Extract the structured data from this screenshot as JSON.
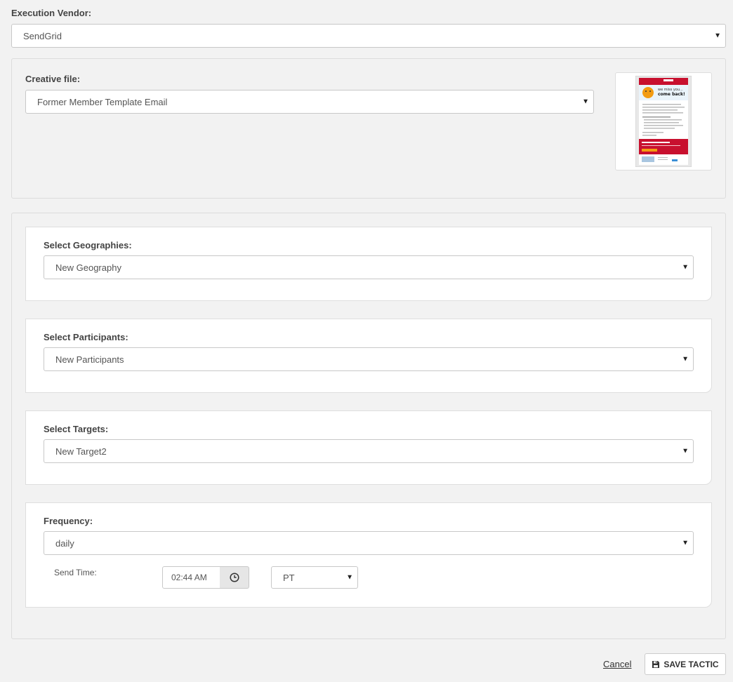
{
  "vendor": {
    "label": "Execution Vendor:",
    "value": "SendGrid"
  },
  "creative": {
    "label": "Creative file:",
    "value": "Former Member Template Email"
  },
  "geographies": {
    "label": "Select Geographies:",
    "value": "New Geography"
  },
  "participants": {
    "label": "Select Participants:",
    "value": "New Participants"
  },
  "targets": {
    "label": "Select Targets:",
    "value": "New Target2"
  },
  "frequency": {
    "label": "Frequency:",
    "value": "daily",
    "send_time_label": "Send Time:",
    "send_time_value": "02:44 AM",
    "timezone": "PT"
  },
  "actions": {
    "cancel": "Cancel",
    "save": "SAVE TACTIC"
  },
  "thumbnail": {
    "headline": "we miss you... come back!"
  },
  "colors": {
    "brand_red": "#c8102e",
    "accent_orange": "#f39c12"
  }
}
